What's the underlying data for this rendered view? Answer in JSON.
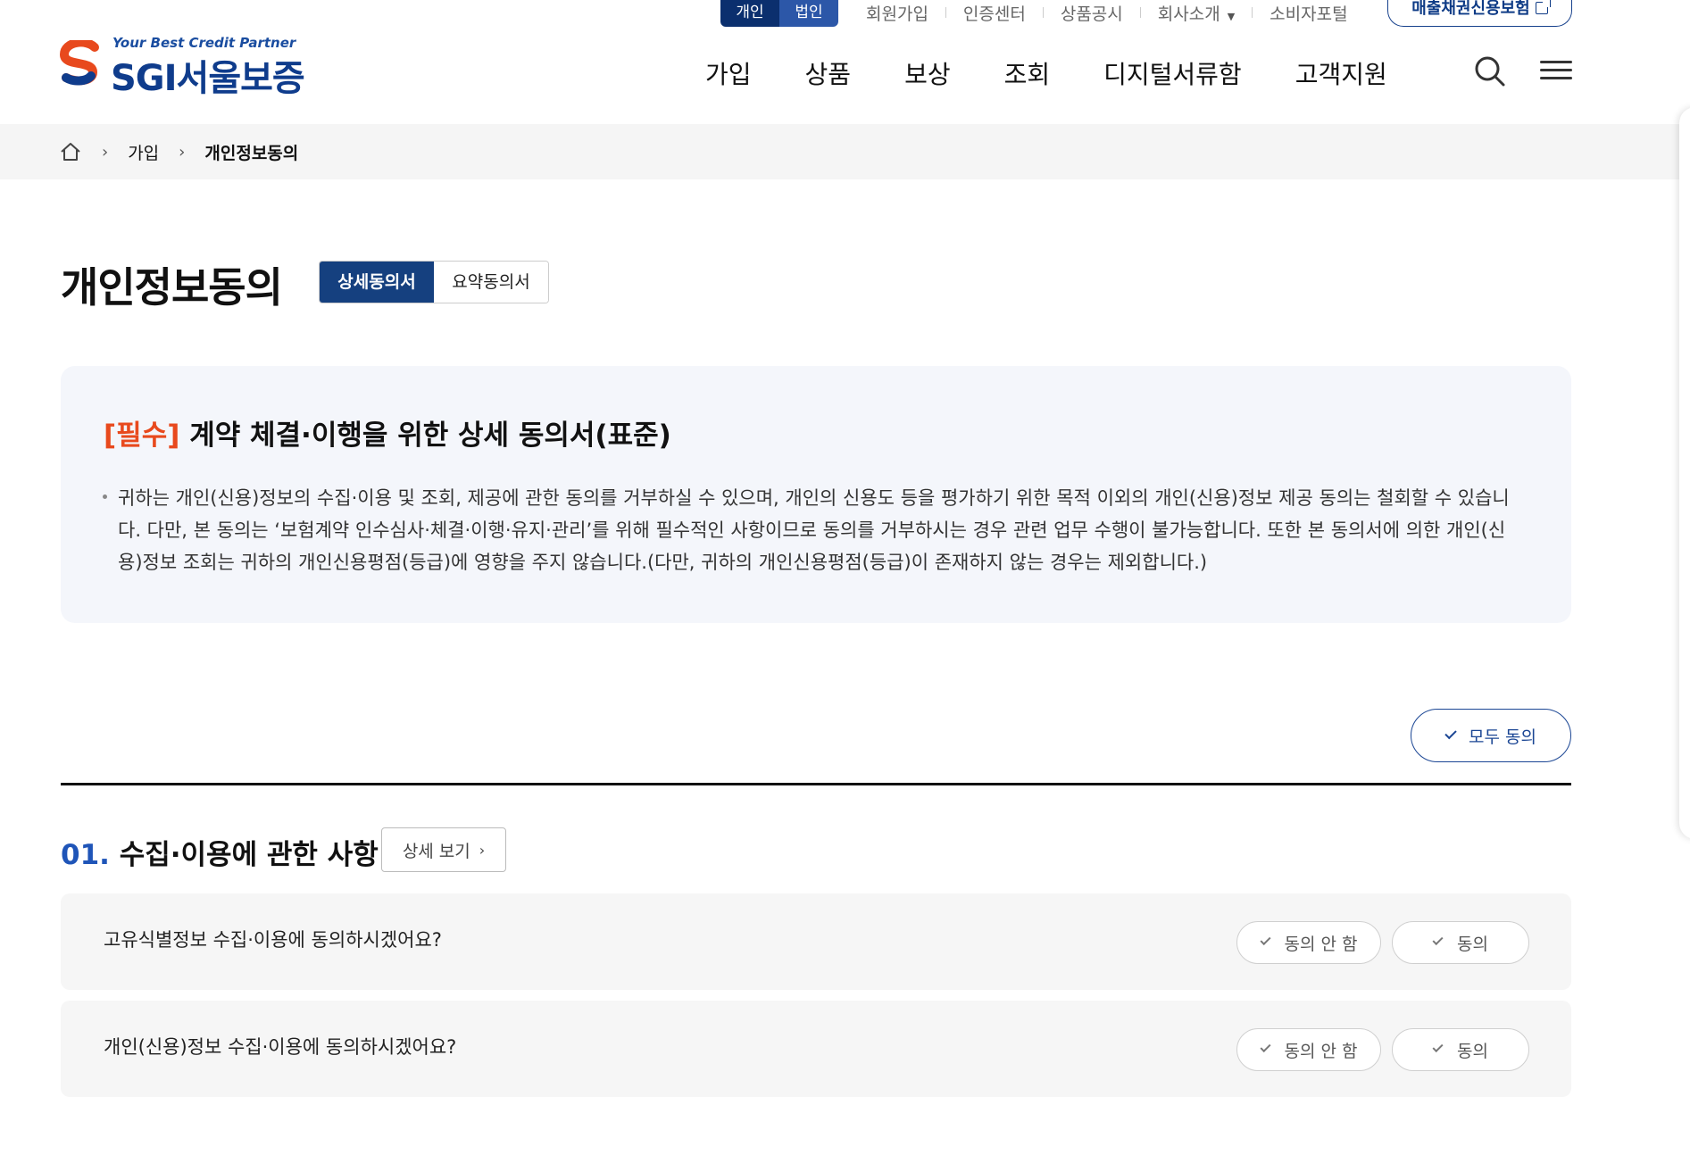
{
  "header": {
    "segment": {
      "personal": "개인",
      "corporate": "법인"
    },
    "util_links": [
      "회원가입",
      "인증센터",
      "상품공시",
      "회사소개",
      "소비자포털"
    ],
    "external_button": "매출채권신용보험",
    "logo_tagline": "Your Best Credit Partner",
    "logo_text": "SGI서울보증",
    "gnb": [
      "가입",
      "상품",
      "보상",
      "조회",
      "디지털서류함",
      "고객지원"
    ],
    "brand_color": "#0f3c8c",
    "accent_color": "#e8491d"
  },
  "breadcrumb": {
    "level1": "가입",
    "current": "개인정보동의"
  },
  "page": {
    "title": "개인정보동의",
    "tabs": [
      {
        "label": "상세동의서",
        "active": true
      },
      {
        "label": "요약동의서",
        "active": false
      }
    ]
  },
  "notice": {
    "required_tag": "[필수]",
    "title": "계약 체결·이행을 위한 상세 동의서(표준)",
    "text": "귀하는 개인(신용)정보의 수집·이용 및 조회, 제공에 관한 동의를 거부하실 수 있으며, 개인의 신용도 등을 평가하기 위한 목적 이외의 개인(신용)정보 제공 동의는 철회할 수 있습니다. 다만, 본 동의는 ‘보험계약 인수심사·체결·이행·유지·관리’를 위해 필수적인 사항이므로 동의를 거부하시는 경우 관련 업무 수행이 불가능합니다. 또한 본 동의서에 의한 개인(신용)정보 조회는 귀하의 개인신용평점(등급)에 영향을 주지 않습니다.(다만, 귀하의 개인신용평점(등급)이 존재하지 않는 경우는 제외합니다.)"
  },
  "all_agree_label": "모두 동의",
  "section": {
    "number": "01.",
    "title": "수집·이용에 관한 사항",
    "detail_button": "상세 보기",
    "questions": [
      {
        "text": "고유식별정보 수집·이용에 동의하시겠어요?",
        "disagree": "동의 안 함",
        "agree": "동의"
      },
      {
        "text": "개인(신용)정보 수집·이용에 동의하시겠어요?",
        "disagree": "동의 안 함",
        "agree": "동의"
      }
    ]
  }
}
